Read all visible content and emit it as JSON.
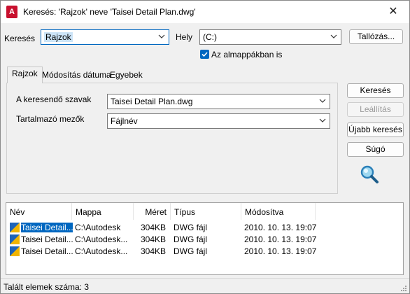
{
  "window": {
    "title": "Keresés: 'Rajzok' neve 'Taisei Detail Plan.dwg'",
    "app_icon_letter": "A",
    "close_glyph": "✕"
  },
  "search": {
    "label": "Keresés",
    "value": "Rajzok",
    "location_label": "Hely",
    "location_value": "(C:)",
    "browse_label": "Tallózás...",
    "subfolders_label": "Az almappákban is",
    "subfolders_checked": true
  },
  "tabs": [
    {
      "label": "Rajzok",
      "active": true
    },
    {
      "label": "Módosítás dátuma",
      "active": false
    },
    {
      "label": "Egyebek",
      "active": false
    }
  ],
  "form": {
    "words_label": "A keresendő szavak",
    "words_value": "Taisei Detail Plan.dwg",
    "fields_label": "Tartalmazó mezők",
    "fields_value": "Fájlnév"
  },
  "actions": {
    "search": "Keresés",
    "stop": "Leállítás",
    "new_search": "Újabb keresés",
    "help": "Súgó"
  },
  "results": {
    "columns": [
      "Név",
      "Mappa",
      "Méret",
      "Típus",
      "Módosítva"
    ],
    "rows": [
      [
        "Taisei Detail...",
        "C:\\Autodesk",
        "304KB",
        "DWG fájl",
        "2010. 10. 13. 19:07"
      ],
      [
        "Taisei Detail...",
        "C:\\Autodesk...",
        "304KB",
        "DWG fájl",
        "2010. 10. 13. 19:07"
      ],
      [
        "Taisei Detail...",
        "C:\\Autodesk...",
        "304KB",
        "DWG fájl",
        "2010. 10. 13. 19:07"
      ]
    ]
  },
  "status": {
    "text": "Talált elemek száma: 3"
  },
  "colors": {
    "accent": "#0067c0",
    "selection": "#cce4f7",
    "app_icon": "#c8102e"
  },
  "icons": {
    "magnifier": "magnifier-icon",
    "file": "dwg-file-icon"
  }
}
